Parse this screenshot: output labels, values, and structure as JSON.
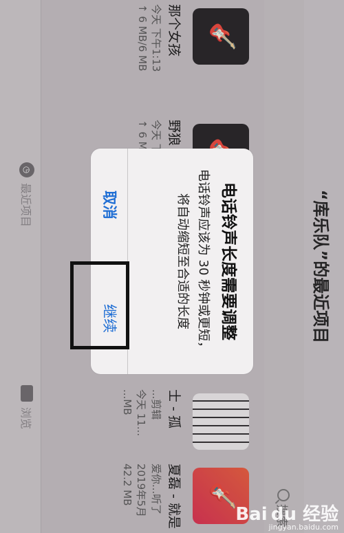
{
  "header": {
    "title": "“库乐队”的最近项目"
  },
  "search": {
    "label": "搜索"
  },
  "files": [
    {
      "name": "那个女孩",
      "meta1": "今天 下午1:13",
      "meta2": "↑ 6 MB/6 MB",
      "thumb": "guitar-icon"
    },
    {
      "name": "野狼 d",
      "meta1": "今天 下",
      "meta2": "↑ 6 MB/",
      "thumb": "guitar-icon"
    },
    {
      "name": "士 - 孤",
      "meta1": "...剪辑",
      "meta2": "今天 11...",
      "meta3": "...MB",
      "thumb": "piano-icon"
    },
    {
      "name": "夏磊 - 就是",
      "meta1": "爱你...听了",
      "meta2": "2019年5月",
      "meta3": "42.2 MB",
      "thumb": "guitar-icon"
    }
  ],
  "tabs": {
    "recent": "最近项目",
    "browse": "浏览"
  },
  "alert": {
    "title": "电话铃声长度需要调整",
    "message": "电话铃声应该为 30 秒钟或更短，将自动缩短至合适的长度",
    "cancel_label": "取消",
    "continue_label": "继续",
    "accent": "#1f6ed4"
  },
  "watermark": {
    "brand": "Bai du 经验",
    "url": "jingyan.baidu.com"
  }
}
